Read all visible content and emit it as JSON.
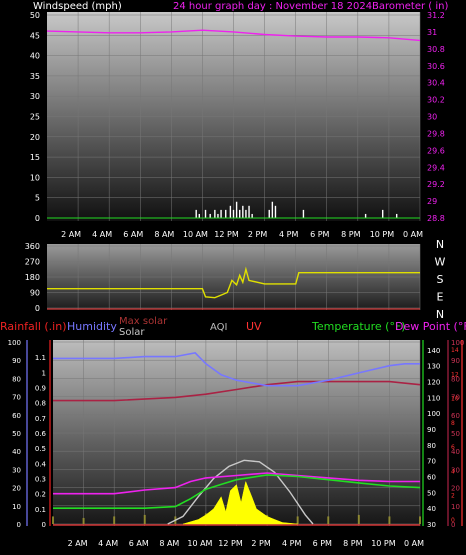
{
  "header": {
    "left_label": "Windspeed (mph)",
    "title": "24 hour graph day : November 18 2024",
    "right_label": "Barometer ( in)"
  },
  "colors": {
    "wind": "#ffffff",
    "wind_dir": "#e0e000",
    "barometer": "#ee22ee",
    "rainfall": "#ee2222",
    "humidity": "#7777ff",
    "max_solar": "#c8c8c8",
    "solar": "#ffff00",
    "aqi": "#bbbbbb",
    "uv": "#ff3333",
    "temperature": "#22dd22",
    "dew_point": "#aa2244",
    "axis_text": "#ffffff"
  },
  "x_ticks": [
    "2 AM",
    "4 AM",
    "6 AM",
    "8 AM",
    "10 AM",
    "12 PM",
    "2 PM",
    "4 PM",
    "6 PM",
    "8 PM",
    "10 PM",
    "0 AM"
  ],
  "chart_data": [
    {
      "type": "line",
      "title": "24 hour graph day : November 18 2024",
      "x_range": [
        0,
        24
      ],
      "series": [
        {
          "name": "Windspeed (mph)",
          "axis": "left",
          "ylim": [
            0,
            50
          ],
          "y_ticks": [
            0,
            5,
            10,
            15,
            20,
            25,
            30,
            35,
            40,
            45,
            50
          ],
          "values": [
            [
              9.5,
              0
            ],
            [
              9.6,
              2
            ],
            [
              9.8,
              1
            ],
            [
              10.2,
              2
            ],
            [
              10.5,
              1
            ],
            [
              10.8,
              2
            ],
            [
              11,
              1
            ],
            [
              11.2,
              2
            ],
            [
              11.5,
              2
            ],
            [
              11.8,
              3
            ],
            [
              12,
              2
            ],
            [
              12.2,
              4
            ],
            [
              12.4,
              2
            ],
            [
              12.6,
              3
            ],
            [
              12.8,
              2
            ],
            [
              13,
              3
            ],
            [
              13.2,
              1
            ],
            [
              14.3,
              2
            ],
            [
              14.5,
              4
            ],
            [
              14.7,
              3
            ],
            [
              16.5,
              2
            ],
            [
              20.5,
              1
            ],
            [
              21.6,
              2
            ],
            [
              22.5,
              1
            ]
          ]
        },
        {
          "name": "Barometer ( in)",
          "axis": "right",
          "ylim": [
            28.8,
            31.2
          ],
          "y_ticks": [
            "28.8",
            "29",
            "29.2",
            "29.4",
            "29.6",
            "29.8",
            "30",
            "30.2",
            "30.4",
            "30.6",
            "30.8",
            "31",
            "31.2"
          ],
          "values": [
            [
              0,
              31.01
            ],
            [
              2,
              31.0
            ],
            [
              4,
              30.99
            ],
            [
              6,
              30.99
            ],
            [
              8,
              31.0
            ],
            [
              10,
              31.02
            ],
            [
              12,
              31.0
            ],
            [
              14,
              30.97
            ],
            [
              16,
              30.95
            ],
            [
              18,
              30.94
            ],
            [
              20,
              30.94
            ],
            [
              22,
              30.93
            ],
            [
              24,
              30.9
            ]
          ]
        }
      ]
    },
    {
      "type": "line",
      "x_range": [
        0,
        24
      ],
      "ylim": [
        0,
        360
      ],
      "y_ticks": [
        "0",
        "90",
        "180",
        "270",
        "360"
      ],
      "direction_labels": [
        "N",
        "W",
        "S",
        "E",
        "N"
      ],
      "series": [
        {
          "name": "Wind direction",
          "values": [
            [
              0,
              112
            ],
            [
              2,
              112
            ],
            [
              4,
              112
            ],
            [
              6,
              112
            ],
            [
              8,
              112
            ],
            [
              9.3,
              112
            ],
            [
              10,
              112
            ],
            [
              10.2,
              65
            ],
            [
              10.8,
              60
            ],
            [
              11.2,
              75
            ],
            [
              11.6,
              90
            ],
            [
              11.9,
              160
            ],
            [
              12.2,
              135
            ],
            [
              12.4,
              190
            ],
            [
              12.6,
              150
            ],
            [
              12.8,
              225
            ],
            [
              13,
              160
            ],
            [
              14,
              140
            ],
            [
              16,
              140
            ],
            [
              16.2,
              205
            ],
            [
              18,
              205
            ],
            [
              20,
              205
            ],
            [
              22,
              205
            ],
            [
              24,
              205
            ]
          ]
        }
      ]
    },
    {
      "type": "line",
      "x_range": [
        0,
        24
      ],
      "legend": [
        "Rainfall (.in)",
        "Humidity",
        "Max solar",
        "Solar",
        "AQI",
        "UV",
        "Temperature (°F)",
        "Dew Point (°F)"
      ],
      "axes": {
        "humidity": {
          "ylim": [
            0,
            100
          ],
          "ticks": [
            "0",
            "10",
            "20",
            "30",
            "40",
            "50",
            "60",
            "70",
            "80",
            "90",
            "100"
          ]
        },
        "rainfall": {
          "ylim": [
            0,
            1.2
          ],
          "ticks": [
            "0",
            "0.1",
            "0.2",
            "0.3",
            "0.4",
            "0.5",
            "0.6",
            "0.7",
            "0.8",
            "0.9",
            "1",
            "1.1"
          ]
        },
        "temperature": {
          "ylim": [
            30,
            145
          ],
          "ticks": [
            "30",
            "40",
            "50",
            "60",
            "70",
            "80",
            "90",
            "100",
            "110",
            "120",
            "130",
            "140"
          ]
        },
        "dew_point": {
          "ylim": [
            0,
            100
          ],
          "ticks": [
            "0",
            "10",
            "20",
            "30",
            "40",
            "50",
            "60",
            "70",
            "80",
            "90",
            "100"
          ]
        },
        "uv": {
          "ylim": [
            0,
            15
          ],
          "ticks": [
            "0",
            "2",
            "4",
            "6",
            "8",
            "10",
            "12",
            "14"
          ]
        }
      },
      "series": [
        {
          "name": "Humidity",
          "axis": "humidity",
          "values": [
            [
              0,
              91
            ],
            [
              4,
              91
            ],
            [
              6,
              92
            ],
            [
              8,
              92
            ],
            [
              9.3,
              94
            ],
            [
              10,
              88
            ],
            [
              11,
              82
            ],
            [
              12,
              79
            ],
            [
              14,
              76
            ],
            [
              16,
              76
            ],
            [
              18,
              79
            ],
            [
              20,
              83
            ],
            [
              22,
              87
            ],
            [
              23,
              88
            ],
            [
              24,
              88
            ]
          ]
        },
        {
          "name": "Dew Point (°F)",
          "axis": "temperature",
          "values": [
            [
              0,
              108
            ],
            [
              4,
              108
            ],
            [
              8,
              110
            ],
            [
              10,
              112
            ],
            [
              12,
              115
            ],
            [
              14,
              118
            ],
            [
              16,
              120
            ],
            [
              18,
              120
            ],
            [
              20,
              120
            ],
            [
              22,
              120
            ],
            [
              24,
              118
            ]
          ]
        },
        {
          "name": "Temperature (°F)",
          "axis": "temperature",
          "values": [
            [
              0,
              40
            ],
            [
              4,
              40
            ],
            [
              6,
              40
            ],
            [
              8,
              41
            ],
            [
              9,
              46
            ],
            [
              10,
              52
            ],
            [
              11,
              55
            ],
            [
              12,
              58
            ],
            [
              14,
              61
            ],
            [
              16,
              60
            ],
            [
              18,
              58
            ],
            [
              20,
              56
            ],
            [
              22,
              54
            ],
            [
              24,
              53
            ]
          ]
        },
        {
          "name": "UV",
          "axis": "uv",
          "values": [
            [
              0,
              2.5
            ],
            [
              2,
              2.5
            ],
            [
              4,
              2.5
            ],
            [
              6,
              2.8
            ],
            [
              8,
              3
            ],
            [
              9,
              3.5
            ],
            [
              10,
              3.8
            ],
            [
              12,
              4
            ],
            [
              14,
              4.2
            ],
            [
              16,
              4
            ],
            [
              18,
              3.8
            ],
            [
              20,
              3.6
            ],
            [
              22,
              3.5
            ],
            [
              24,
              3.5
            ]
          ]
        },
        {
          "name": "Max solar",
          "axis": "rainfall",
          "values": [
            [
              7.5,
              0
            ],
            [
              8.5,
              0.05
            ],
            [
              9.5,
              0.18
            ],
            [
              10.5,
              0.3
            ],
            [
              11.5,
              0.38
            ],
            [
              12.5,
              0.42
            ],
            [
              13.5,
              0.41
            ],
            [
              14.5,
              0.34
            ],
            [
              15.5,
              0.21
            ],
            [
              16.5,
              0.06
            ],
            [
              17,
              0
            ]
          ]
        },
        {
          "name": "Solar",
          "axis": "rainfall",
          "values": [
            [
              8.5,
              0
            ],
            [
              9.5,
              0.03
            ],
            [
              10,
              0.06
            ],
            [
              10.5,
              0.1
            ],
            [
              11,
              0.18
            ],
            [
              11.3,
              0.08
            ],
            [
              11.6,
              0.22
            ],
            [
              12,
              0.26
            ],
            [
              12.3,
              0.14
            ],
            [
              12.6,
              0.28
            ],
            [
              13,
              0.18
            ],
            [
              13.3,
              0.1
            ],
            [
              14,
              0.05
            ],
            [
              14.5,
              0.03
            ],
            [
              15,
              0.01
            ],
            [
              16,
              0
            ]
          ]
        },
        {
          "name": "AQI",
          "axis": "rainfall",
          "values": [
            [
              0,
              0.05
            ],
            [
              2,
              0.04
            ],
            [
              4,
              0.05
            ],
            [
              6,
              0.06
            ],
            [
              8,
              0.05
            ],
            [
              10,
              0.07
            ],
            [
              12,
              0.08
            ],
            [
              14,
              0.06
            ],
            [
              16,
              0.05
            ],
            [
              18,
              0.05
            ],
            [
              20,
              0.06
            ],
            [
              22,
              0.05
            ],
            [
              24,
              0.05
            ]
          ]
        }
      ]
    }
  ]
}
